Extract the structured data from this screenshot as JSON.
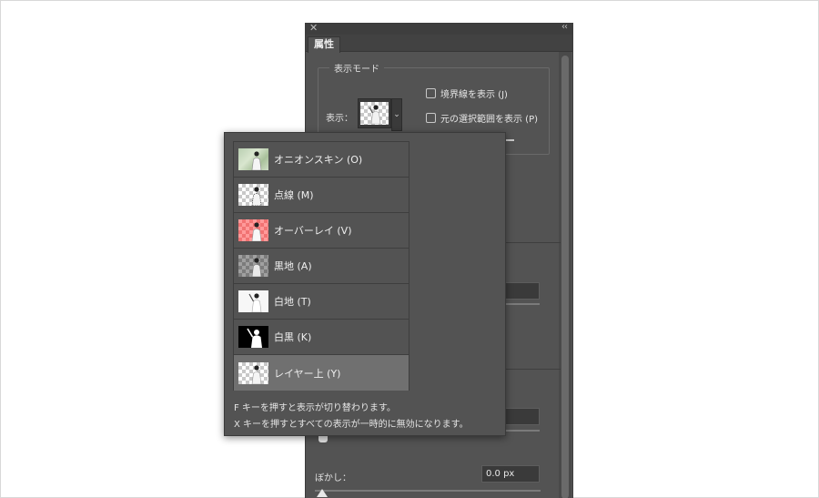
{
  "panel": {
    "tab_label": "属性",
    "close_glyph": "✕",
    "collapse_glyph": "‹‹",
    "view_mode_group_title": "表示モード",
    "view_label": "表示：",
    "show_edge_label": "境界線を表示 (J)",
    "show_original_label": "元の選択範囲を表示 (P)",
    "feather_label": "ぼかし：",
    "feather_value": "0.0 px"
  },
  "popup": {
    "modes": [
      {
        "label": "オニオンスキン (O)",
        "thumb": "onion-skin",
        "selected": false
      },
      {
        "label": "点線 (M)",
        "thumb": "marching-ants",
        "selected": false
      },
      {
        "label": "オーバーレイ (V)",
        "thumb": "overlay",
        "selected": false
      },
      {
        "label": "黒地 (A)",
        "thumb": "on-black",
        "selected": false
      },
      {
        "label": "白地 (T)",
        "thumb": "on-white",
        "selected": false
      },
      {
        "label": "白黒 (K)",
        "thumb": "black-and-white",
        "selected": false
      },
      {
        "label": "レイヤー上 (Y)",
        "thumb": "on-layers",
        "selected": true
      }
    ],
    "hint_f": "F キーを押すと表示が切り替わります。",
    "hint_x": "X キーを押すとすべての表示が一時的に無効になります。"
  },
  "colors": {
    "panel_bg": "#535353",
    "selected_row": "#707070",
    "overlay_red": "#ff9a9a"
  }
}
